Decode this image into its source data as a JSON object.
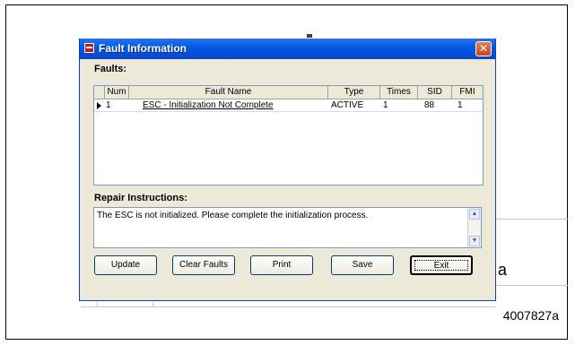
{
  "window": {
    "title": "Fault Information",
    "close_glyph": "✕",
    "icon": "app-icon"
  },
  "faults": {
    "label": "Faults:",
    "columns": [
      "Num",
      "Fault Name",
      "Type",
      "Times",
      "SID",
      "FMI"
    ],
    "rows": [
      {
        "num": "1",
        "fault_name": "ESC - Initialization Not Complete",
        "type": "ACTIVE",
        "times": "1",
        "sid": "88",
        "fmi": "1"
      }
    ]
  },
  "repair": {
    "label": "Repair Instructions:",
    "text": "The ESC is not initialized.  Please complete the initialization process."
  },
  "buttons": {
    "update": "Update",
    "clear_faults": "Clear Faults",
    "print": "Print",
    "save": "Save",
    "exit": "Exit"
  },
  "figure_id": "4007827a",
  "accent_color": "#0058e6"
}
